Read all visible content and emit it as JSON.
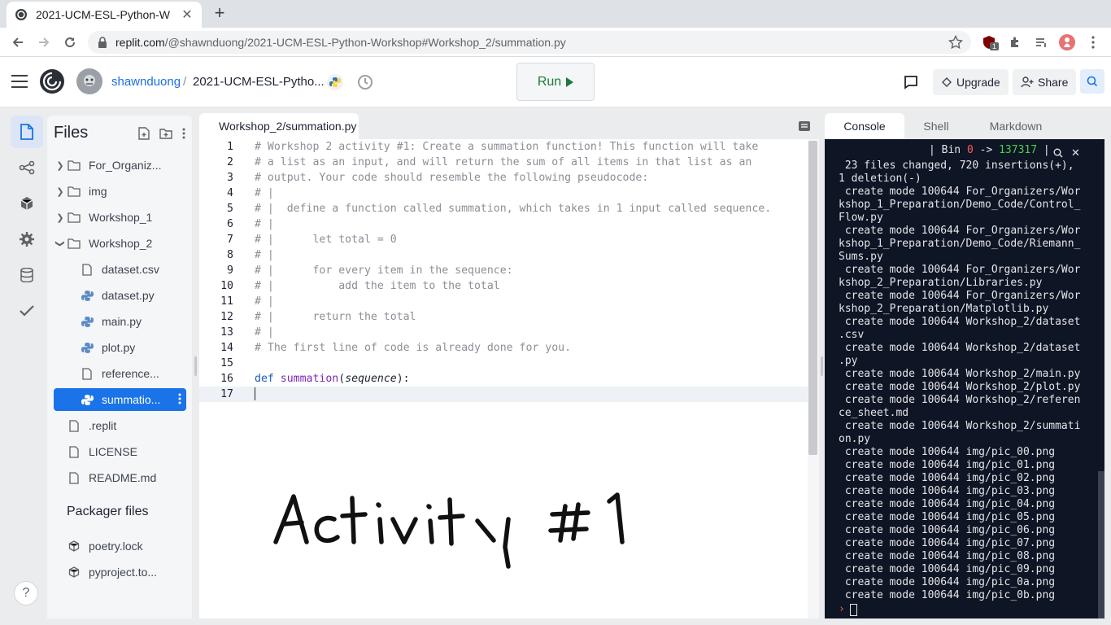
{
  "browser": {
    "tab_title": "2021-UCM-ESL-Python-W",
    "url_host": "replit.com",
    "url_path": "/@shawnduong/2021-UCM-ESL-Python-Workshop#Workshop_2/summation.py",
    "extension_badge": "1"
  },
  "header": {
    "user": "shawnduong",
    "separator": "/",
    "repl_name": "2021-UCM-ESL-Pytho...",
    "run_label": "Run",
    "upgrade_label": "Upgrade",
    "share_label": "Share"
  },
  "files": {
    "title": "Files",
    "items": [
      {
        "label": "For_Organiz...",
        "type": "folder",
        "state": "collapsed"
      },
      {
        "label": "img",
        "type": "folder",
        "state": "collapsed"
      },
      {
        "label": "Workshop_1",
        "type": "folder",
        "state": "collapsed"
      },
      {
        "label": "Workshop_2",
        "type": "folder",
        "state": "expanded"
      },
      {
        "label": "dataset.csv",
        "type": "file"
      },
      {
        "label": "dataset.py",
        "type": "python"
      },
      {
        "label": "main.py",
        "type": "python"
      },
      {
        "label": "plot.py",
        "type": "python"
      },
      {
        "label": "reference...",
        "type": "file"
      },
      {
        "label": "summatio...",
        "type": "python",
        "selected": true
      },
      {
        "label": ".replit",
        "type": "file"
      },
      {
        "label": "LICENSE",
        "type": "file"
      },
      {
        "label": "README.md",
        "type": "file"
      }
    ],
    "packager_title": "Packager files",
    "packager_items": [
      {
        "label": "poetry.lock"
      },
      {
        "label": "pyproject.to..."
      }
    ]
  },
  "editor": {
    "tab_label": "Workshop_2/summation.py",
    "line_numbers": [
      "1",
      "2",
      "3",
      "4",
      "5",
      "6",
      "7",
      "8",
      "9",
      "10",
      "11",
      "12",
      "13",
      "14",
      "15",
      "16",
      "17"
    ],
    "comment_lines": [
      "# Workshop 2 activity #1: Create a summation function! This function will take",
      "# a list as an input, and will return the sum of all items in that list as an",
      "# output. Your code should resemble the following pseudocode:",
      "# |",
      "# |  define a function called summation, which takes in 1 input called sequence.",
      "# |",
      "# |      let total = 0",
      "# |",
      "# |      for every item in the sequence:",
      "# |          add the item to the total",
      "# |",
      "# |      return the total",
      "# |",
      "# The first line of code is already done for you.",
      ""
    ],
    "def_keyword": "def",
    "function_name": "summation",
    "open_paren": "(",
    "param_name": "sequence",
    "close_paren": "):",
    "annotation": "Activity #1"
  },
  "console": {
    "tabs": [
      "Console",
      "Shell",
      "Markdown"
    ],
    "toolbar_bin": "| Bin ",
    "toolbar_zero": "0",
    "toolbar_arrow": " -> ",
    "toolbar_count": "137317",
    "toolbar_pipe": " |",
    "close_glyph": "✕",
    "lines": [
      " 23 files changed, 720 insertions(+),",
      "1 deletion(-)",
      " create mode 100644 For_Organizers/Wor",
      "kshop_1_Preparation/Demo_Code/Control_",
      "Flow.py",
      " create mode 100644 For_Organizers/Wor",
      "kshop_1_Preparation/Demo_Code/Riemann_",
      "Sums.py",
      " create mode 100644 For_Organizers/Wor",
      "kshop_2_Preparation/Libraries.py",
      " create mode 100644 For_Organizers/Wor",
      "kshop_2_Preparation/Matplotlib.py",
      " create mode 100644 Workshop_2/dataset",
      ".csv",
      " create mode 100644 Workshop_2/dataset",
      ".py",
      " create mode 100644 Workshop_2/main.py",
      " create mode 100644 Workshop_2/plot.py",
      " create mode 100644 Workshop_2/referen",
      "ce_sheet.md",
      " create mode 100644 Workshop_2/summati",
      "on.py",
      " create mode 100644 img/pic_00.png",
      " create mode 100644 img/pic_01.png",
      " create mode 100644 img/pic_02.png",
      " create mode 100644 img/pic_03.png",
      " create mode 100644 img/pic_04.png",
      " create mode 100644 img/pic_05.png",
      " create mode 100644 img/pic_06.png",
      " create mode 100644 img/pic_07.png",
      " create mode 100644 img/pic_08.png",
      " create mode 100644 img/pic_09.png",
      " create mode 100644 img/pic_0a.png",
      " create mode 100644 img/pic_0b.png"
    ],
    "prompt": "›"
  },
  "help_label": "?",
  "colors": {
    "accent": "#1a73e8",
    "run_green": "#1a7a38",
    "console_bg": "#0e1525",
    "keyword": "#1d5bbf",
    "function": "#7b26b5"
  },
  "icons": [
    "replit-logo",
    "hamburger-icon",
    "python-icon",
    "history-icon",
    "chat-icon",
    "upgrade-icon",
    "share-icon",
    "search-icon",
    "files-icon",
    "git-icon",
    "packages-icon",
    "settings-icon",
    "database-icon",
    "unit-tests-icon",
    "new-file-icon",
    "new-folder-icon",
    "kebab-icon",
    "folder-icon",
    "file-icon",
    "package-icon"
  ]
}
